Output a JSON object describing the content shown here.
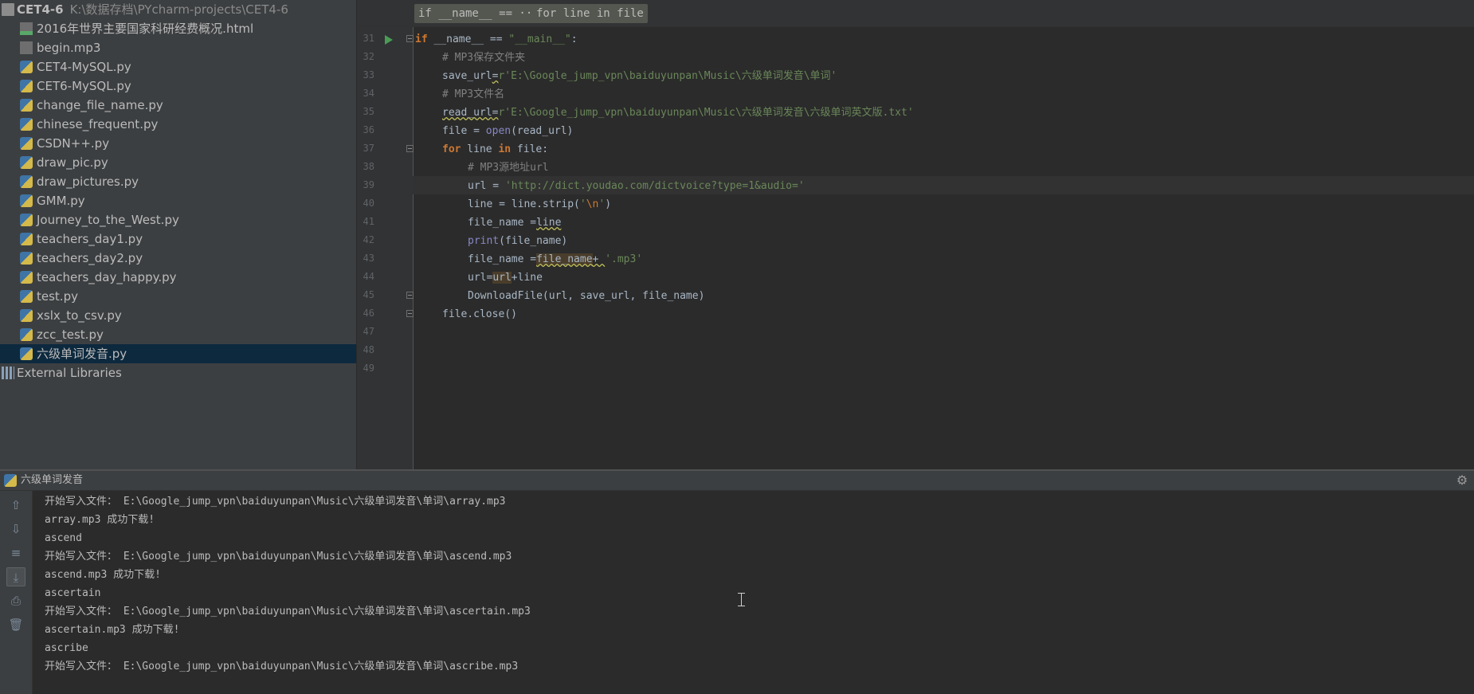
{
  "project": {
    "name": "CET4-6",
    "path": "K:\\数据存档\\PYcharm-projects\\CET4-6",
    "files": [
      {
        "name": "2016年世界主要国家科研经费概况.html",
        "type": "html"
      },
      {
        "name": "begin.mp3",
        "type": "audio"
      },
      {
        "name": "CET4-MySQL.py",
        "type": "python"
      },
      {
        "name": "CET6-MySQL.py",
        "type": "python"
      },
      {
        "name": "change_file_name.py",
        "type": "python"
      },
      {
        "name": "chinese_frequent.py",
        "type": "python"
      },
      {
        "name": "CSDN++.py",
        "type": "python"
      },
      {
        "name": "draw_pic.py",
        "type": "python"
      },
      {
        "name": "draw_pictures.py",
        "type": "python"
      },
      {
        "name": "GMM.py",
        "type": "python"
      },
      {
        "name": "Journey_to_the_West.py",
        "type": "python"
      },
      {
        "name": "teachers_day1.py",
        "type": "python"
      },
      {
        "name": "teachers_day2.py",
        "type": "python"
      },
      {
        "name": "teachers_day_happy.py",
        "type": "python"
      },
      {
        "name": "test.py",
        "type": "python"
      },
      {
        "name": "xslx_to_csv.py",
        "type": "python"
      },
      {
        "name": "zcc_test.py",
        "type": "python"
      },
      {
        "name": "六级单词发音.py",
        "type": "python",
        "selected": true
      }
    ],
    "external_libraries": "External Libraries"
  },
  "editor": {
    "breadcrumbs": [
      "if __name__ == ···",
      "for line in file"
    ],
    "line_numbers": [
      "31",
      "32",
      "33",
      "34",
      "35",
      "36",
      "37",
      "38",
      "39",
      "40",
      "41",
      "42",
      "43",
      "44",
      "45",
      "46",
      "47",
      "48",
      "49"
    ],
    "code": {
      "l31": {
        "kw": "if",
        "mid": " __name__ == ",
        "str": "\"__main__\"",
        "end": ":"
      },
      "l32": {
        "comment": "# MP3保存文件夹"
      },
      "l33": {
        "name": "save_url",
        "op": "=",
        "str": "r'E:\\Google_jump_vpn\\baiduyunpan\\Music\\六级单词发音\\单词'"
      },
      "l34": {
        "comment": "# MP3文件名"
      },
      "l35": {
        "name": "read_url",
        "op": "=",
        "str": "r'E:\\Google_jump_vpn\\baiduyunpan\\Music\\六级单词发音\\六级单词英文版.txt'"
      },
      "l36": {
        "pre": "file = ",
        "builtin": "open",
        "post": "(read_url)"
      },
      "l37": {
        "kw1": "for",
        "mid1": " line ",
        "kw2": "in",
        "post": " file:"
      },
      "l38": {
        "comment": "# MP3源地址url"
      },
      "l39": {
        "pre": "url = ",
        "str": "'http://dict.youdao.com/dictvoice?type=1&audio='"
      },
      "l40": {
        "pre": "line = line.strip(",
        "q1": "'",
        "esc": "\\n",
        "q2": "'",
        "post": ")"
      },
      "l41": {
        "pre": "file_name =",
        "var": "line"
      },
      "l42": {
        "builtin": "print",
        "post": "(file_name)"
      },
      "l43": {
        "pre": "file_name =",
        "var": "file_name",
        "op": "+ ",
        "str": "'.mp3'"
      },
      "l44": {
        "pre": "url=",
        "var": "url",
        "post": "+line"
      },
      "l45": {
        "text": "DownloadFile(url, save_url, file_name)"
      },
      "l46": {
        "text": "file.close()"
      }
    }
  },
  "run_panel": {
    "title": "六级单词发音",
    "output": [
      "开始写入文件： E:\\Google_jump_vpn\\baiduyunpan\\Music\\六级单词发音\\单词\\array.mp3",
      "array.mp3 成功下载!",
      "ascend",
      "开始写入文件： E:\\Google_jump_vpn\\baiduyunpan\\Music\\六级单词发音\\单词\\ascend.mp3",
      "ascend.mp3 成功下载!",
      "ascertain",
      "开始写入文件： E:\\Google_jump_vpn\\baiduyunpan\\Music\\六级单词发音\\单词\\ascertain.mp3",
      "ascertain.mp3 成功下载!",
      "ascribe",
      "开始写入文件： E:\\Google_jump_vpn\\baiduyunpan\\Music\\六级单词发音\\单词\\ascribe.mp3"
    ],
    "toolbar_icons": [
      "arrow-up-icon",
      "arrow-down-icon",
      "soft-wrap-icon",
      "scroll-to-end-icon",
      "print-icon",
      "trash-icon"
    ]
  },
  "colors": {
    "keyword": "#cc7832",
    "string": "#6a8759",
    "comment": "#808080",
    "builtin": "#8888c6",
    "selection": "#0d293e",
    "run": "#499c54"
  }
}
